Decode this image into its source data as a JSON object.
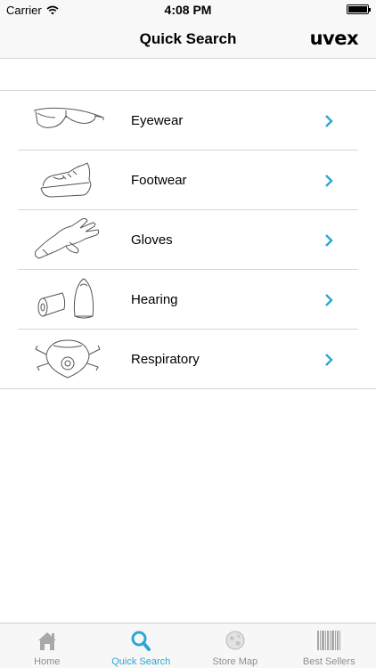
{
  "status_bar": {
    "carrier": "Carrier",
    "time": "4:08 PM"
  },
  "nav": {
    "title": "Quick Search",
    "brand": "uvex"
  },
  "categories": [
    {
      "label": "Eyewear",
      "icon": "eyewear-icon"
    },
    {
      "label": "Footwear",
      "icon": "footwear-icon"
    },
    {
      "label": "Gloves",
      "icon": "gloves-icon"
    },
    {
      "label": "Hearing",
      "icon": "hearing-icon"
    },
    {
      "label": "Respiratory",
      "icon": "respiratory-icon"
    }
  ],
  "tabs": [
    {
      "label": "Home",
      "icon": "home-icon",
      "active": false
    },
    {
      "label": "Quick Search",
      "icon": "search-icon",
      "active": true
    },
    {
      "label": "Store Map",
      "icon": "globe-icon",
      "active": false
    },
    {
      "label": "Best Sellers",
      "icon": "barcode-icon",
      "active": false
    }
  ],
  "colors": {
    "accent": "#2ea6d4",
    "inactive": "#8e8e8e",
    "separator": "#d6d6d6"
  }
}
